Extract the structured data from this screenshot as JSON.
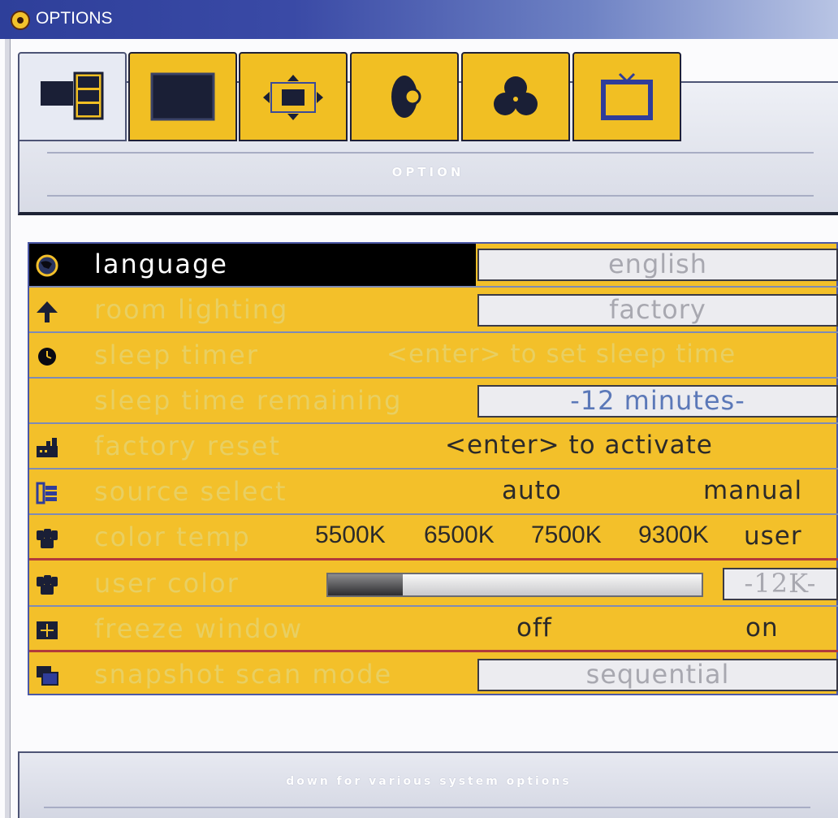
{
  "window": {
    "title": "OPTIONS",
    "app_icon": "monitor-settings-icon"
  },
  "tabs": [
    {
      "icon": "pip-layout-icon",
      "active": true
    },
    {
      "icon": "screen-icon",
      "active": false
    },
    {
      "icon": "position-icon",
      "active": false
    },
    {
      "icon": "audio-icon",
      "active": false
    },
    {
      "icon": "color-icon",
      "active": false
    },
    {
      "icon": "tv-icon",
      "active": false
    }
  ],
  "panel": {
    "title": "OPTION"
  },
  "options": [
    {
      "label": "language",
      "icon": "globe-icon",
      "value": "english"
    },
    {
      "label": "room lighting",
      "icon": "lamp-icon",
      "value": "factory"
    },
    {
      "label": "sleep timer",
      "icon": "clock-icon",
      "hint": "<enter> to set sleep time"
    },
    {
      "label": "sleep time remaining",
      "value": "-12 minutes-"
    },
    {
      "label": "factory reset",
      "icon": "factory-icon",
      "hint": "<enter> to activate"
    },
    {
      "label": "source select",
      "icon": "source-icon",
      "choices": [
        "auto",
        "manual"
      ]
    },
    {
      "label": "color temp",
      "icon": "color-cans-icon",
      "choices": [
        "5500K",
        "6500K",
        "7500K",
        "9300K",
        "user"
      ]
    },
    {
      "label": "user color",
      "icon": "color-cans-icon",
      "level": 0.2,
      "value": "-12K-"
    },
    {
      "label": "freeze window",
      "icon": "freeze-icon",
      "choices": [
        "off",
        "on"
      ]
    },
    {
      "label": "snapshot scan mode",
      "icon": "snapshot-icon",
      "value": "sequential"
    }
  ],
  "help": {
    "text": "down for various system options"
  },
  "colors": {
    "accent": "#f3c02a",
    "selected_bg": "#000000",
    "frame": "#2e3f9a"
  }
}
